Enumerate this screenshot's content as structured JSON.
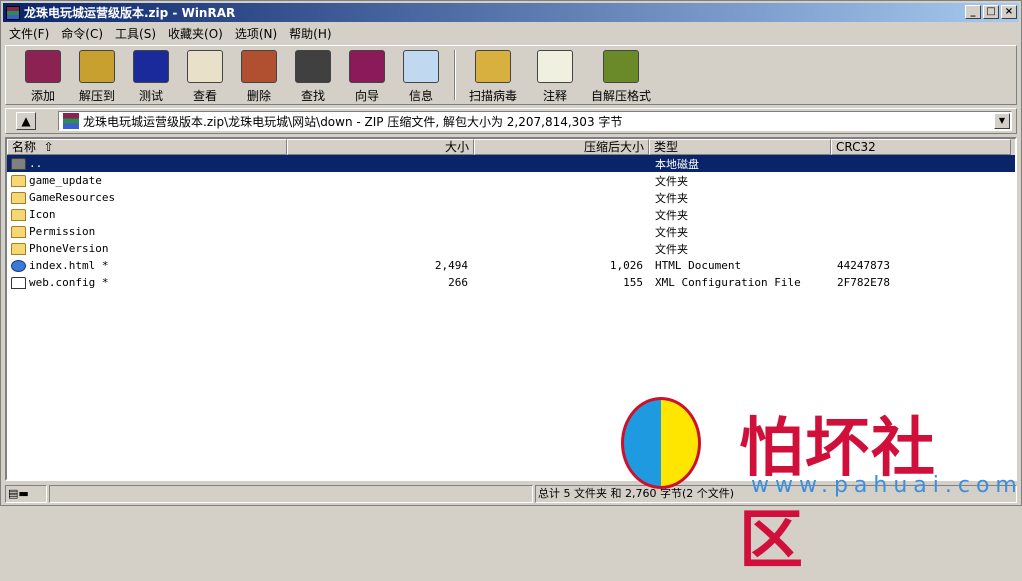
{
  "window": {
    "title": "龙珠电玩城运营级版本.zip - WinRAR"
  },
  "menu": [
    "文件(F)",
    "命令(C)",
    "工具(S)",
    "收藏夹(O)",
    "选项(N)",
    "帮助(H)"
  ],
  "toolbar": [
    {
      "label": "添加",
      "icon": "add-archive-icon",
      "color": "#8b2252"
    },
    {
      "label": "解压到",
      "icon": "extract-to-icon",
      "color": "#c8a030"
    },
    {
      "label": "测试",
      "icon": "test-icon",
      "color": "#1a2a9a"
    },
    {
      "label": "查看",
      "icon": "view-icon",
      "color": "#e8e0c8"
    },
    {
      "label": "删除",
      "icon": "delete-icon",
      "color": "#b05030"
    },
    {
      "label": "查找",
      "icon": "find-icon",
      "color": "#404040"
    },
    {
      "label": "向导",
      "icon": "wizard-icon",
      "color": "#8b1a5a"
    },
    {
      "label": "信息",
      "icon": "info-icon",
      "color": "#c0d8f0"
    },
    {
      "label": "扫描病毒",
      "icon": "virus-scan-icon",
      "color": "#d8b040"
    },
    {
      "label": "注释",
      "icon": "comment-icon",
      "color": "#f0f0e0"
    },
    {
      "label": "自解压格式",
      "icon": "sfx-icon",
      "color": "#6a8a2a"
    }
  ],
  "address": {
    "path": "龙珠电玩城运营级版本.zip\\龙珠电玩城\\网站\\down - ZIP 压缩文件, 解包大小为 2,207,814,303 字节"
  },
  "columns": [
    "名称",
    "大小",
    "压缩后大小",
    "类型",
    "CRC32"
  ],
  "sort_indicator": "⇧",
  "files": [
    {
      "name": "..",
      "size": "",
      "packed": "",
      "type": "本地磁盘",
      "crc": "",
      "icon": "up2"
    },
    {
      "name": "game_update",
      "size": "",
      "packed": "",
      "type": "文件夹",
      "crc": "",
      "icon": "folder"
    },
    {
      "name": "GameResources",
      "size": "",
      "packed": "",
      "type": "文件夹",
      "crc": "",
      "icon": "folder"
    },
    {
      "name": "Icon",
      "size": "",
      "packed": "",
      "type": "文件夹",
      "crc": "",
      "icon": "folder"
    },
    {
      "name": "Permission",
      "size": "",
      "packed": "",
      "type": "文件夹",
      "crc": "",
      "icon": "folder"
    },
    {
      "name": "PhoneVersion",
      "size": "",
      "packed": "",
      "type": "文件夹",
      "crc": "",
      "icon": "folder"
    },
    {
      "name": "index.html *",
      "size": "2,494",
      "packed": "1,026",
      "type": "HTML Document",
      "crc": "44247873",
      "icon": "html"
    },
    {
      "name": "web.config *",
      "size": "266",
      "packed": "155",
      "type": "XML Configuration File",
      "crc": "2F782E78",
      "icon": "cfg"
    }
  ],
  "status": {
    "summary": "总计 5 文件夹 和 2,760 字节(2 个文件)"
  },
  "watermark": {
    "text": "怕坏社区",
    "url": "www.pahuai.com"
  }
}
